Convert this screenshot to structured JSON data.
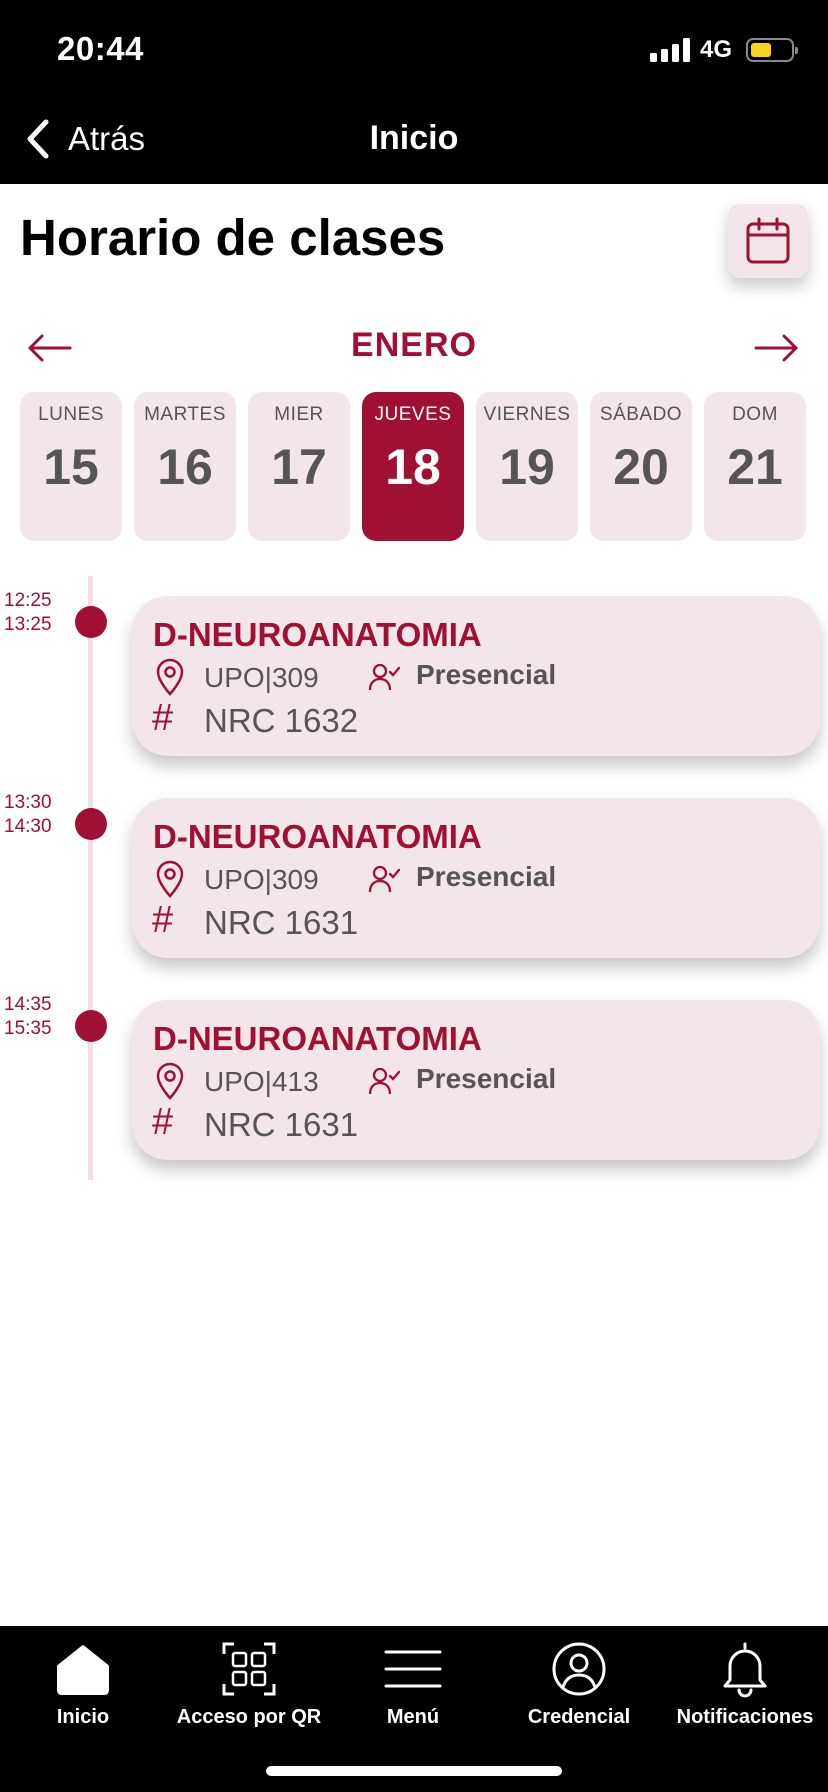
{
  "status_bar": {
    "time": "20:44",
    "network": "4G",
    "battery_color": "#f7d31c"
  },
  "nav": {
    "back_label": "Atrás",
    "title": "Inicio"
  },
  "header": {
    "title": "Horario de clases"
  },
  "calendar": {
    "month": "ENERO",
    "days": [
      {
        "name": "LUNES",
        "number": "15"
      },
      {
        "name": "MARTES",
        "number": "16"
      },
      {
        "name": "MIER",
        "number": "17"
      },
      {
        "name": "JUEVES",
        "number": "18",
        "selected": true
      },
      {
        "name": "VIERNES",
        "number": "19"
      },
      {
        "name": "SÁBADO",
        "number": "20"
      },
      {
        "name": "DOM",
        "number": "21"
      }
    ]
  },
  "schedule": [
    {
      "start": "12:25",
      "end": "13:25",
      "course": "D-NEUROANATOMIA",
      "room": "UPO|309",
      "mode": "Presencial",
      "nrc": "NRC 1632"
    },
    {
      "start": "13:30",
      "end": "14:30",
      "course": "D-NEUROANATOMIA",
      "room": "UPO|309",
      "mode": "Presencial",
      "nrc": "NRC 1631"
    },
    {
      "start": "14:35",
      "end": "15:35",
      "course": "D-NEUROANATOMIA",
      "room": "UPO|413",
      "mode": "Presencial",
      "nrc": "NRC 1631"
    }
  ],
  "tabbar": {
    "items": [
      {
        "label": "Inicio",
        "icon": "home-icon"
      },
      {
        "label": "Acceso por QR",
        "icon": "qr-code-icon"
      },
      {
        "label": "Menú",
        "icon": "hamburger-menu-icon"
      },
      {
        "label": "Credencial",
        "icon": "user-circle-icon"
      },
      {
        "label": "Notificaciones",
        "icon": "bell-icon"
      }
    ]
  },
  "colors": {
    "accent": "#a01033",
    "card_background": "#f2e6ea",
    "timeline": "#f4dde4"
  }
}
